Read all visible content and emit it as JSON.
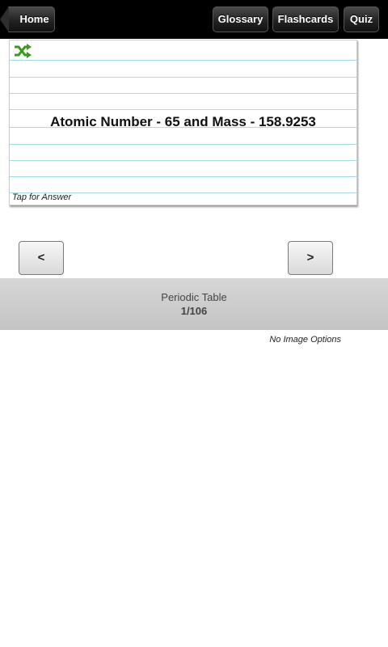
{
  "toolbar": {
    "home_label": "Home",
    "glossary_label": "Glossary",
    "flashcards_label": "Flashcards",
    "quiz_label": "Quiz"
  },
  "card": {
    "shuffle_icon": "shuffle-icon",
    "text": "Atomic Number - 65 and Mass - 158.9253",
    "tap_hint": "Tap for Answer"
  },
  "nav": {
    "prev_label": "<",
    "next_label": ">"
  },
  "deck": {
    "title": "Periodic Table",
    "position": "1/106"
  },
  "options": {
    "no_image_label": "No Image Options"
  },
  "colors": {
    "topbar": "#000000",
    "rule_line": "#a8dde8",
    "shuffle_green": "#3a9a1c",
    "band": "#cfcfcf"
  }
}
